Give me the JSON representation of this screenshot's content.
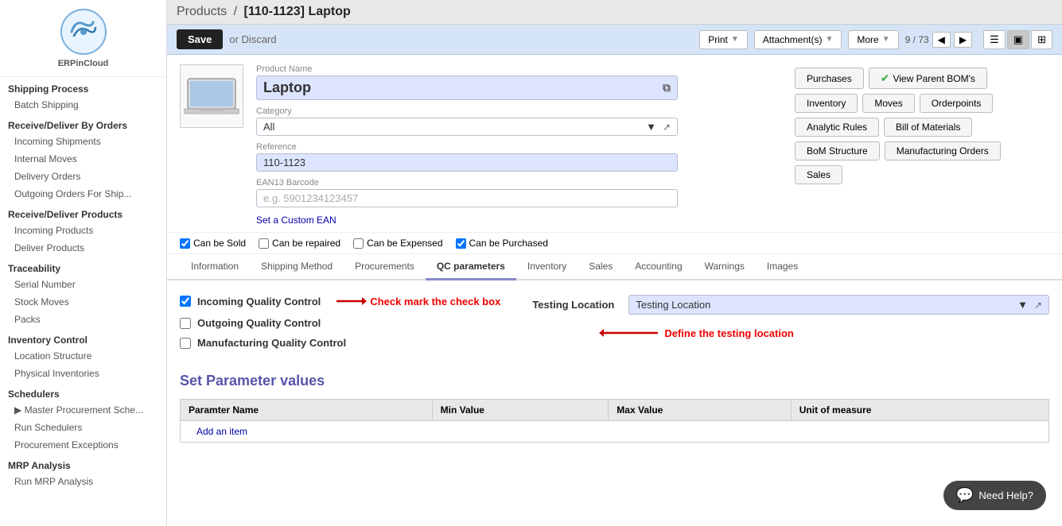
{
  "sidebar": {
    "logo_text": "ERPinCloud",
    "sections": [
      {
        "title": "Shipping Process",
        "items": [
          "Batch Shipping"
        ]
      },
      {
        "title": "Receive/Deliver By Orders",
        "items": [
          "Incoming Shipments",
          "Internal Moves",
          "Delivery Orders",
          "Outgoing Orders For Ship..."
        ]
      },
      {
        "title": "Receive/Deliver Products",
        "items": [
          "Incoming Products",
          "Deliver Products"
        ]
      },
      {
        "title": "Traceability",
        "items": [
          "Serial Number",
          "Stock Moves",
          "Packs"
        ]
      },
      {
        "title": "Inventory Control",
        "items": [
          "Location Structure",
          "Physical Inventories"
        ]
      },
      {
        "title": "Schedulers",
        "items": [
          "▶ Master Procurement Sche...",
          "Run Schedulers",
          "Procurement Exceptions"
        ]
      },
      {
        "title": "MRP Analysis",
        "items": [
          "Run MRP Analysis"
        ]
      }
    ]
  },
  "breadcrumb": {
    "parent": "Products",
    "separator": "/",
    "current": "[110-1123] Laptop"
  },
  "actionbar": {
    "save_label": "Save",
    "discard_label": "or Discard",
    "print_label": "Print",
    "attachments_label": "Attachment(s)",
    "more_label": "More",
    "pagination": "9 / 73"
  },
  "product": {
    "name_label": "Product Name",
    "name_value": "Laptop",
    "category_label": "Category",
    "category_value": "All",
    "reference_label": "Reference",
    "reference_value": "110-1123",
    "ean_label": "EAN13 Barcode",
    "ean_placeholder": "e.g. 5901234123457",
    "custom_ean_label": "Set a Custom EAN"
  },
  "checkboxes": {
    "can_be_sold_label": "Can be Sold",
    "can_be_sold_checked": true,
    "can_be_repaired_label": "Can be repaired",
    "can_be_repaired_checked": false,
    "can_be_expensed_label": "Can be Expensed",
    "can_be_expensed_checked": false,
    "can_be_purchased_label": "Can be Purchased",
    "can_be_purchased_checked": true
  },
  "right_buttons": {
    "purchases_label": "Purchases",
    "view_parent_bom_label": "View Parent BOM's",
    "inventory_label": "Inventory",
    "moves_label": "Moves",
    "orderpoints_label": "Orderpoints",
    "analytic_rules_label": "Analytic Rules",
    "bill_of_materials_label": "Bill of Materials",
    "bom_structure_label": "BoM Structure",
    "manufacturing_orders_label": "Manufacturing Orders",
    "sales_label": "Sales"
  },
  "tabs": {
    "items": [
      {
        "label": "Information",
        "active": false
      },
      {
        "label": "Shipping Method",
        "active": false
      },
      {
        "label": "Procurements",
        "active": false
      },
      {
        "label": "QC parameters",
        "active": true
      },
      {
        "label": "Inventory",
        "active": false
      },
      {
        "label": "Sales",
        "active": false
      },
      {
        "label": "Accounting",
        "active": false
      },
      {
        "label": "Warnings",
        "active": false
      },
      {
        "label": "Images",
        "active": false
      }
    ]
  },
  "qc": {
    "incoming_qc_label": "Incoming Quality Control",
    "incoming_qc_checked": true,
    "outgoing_qc_label": "Outgoing Quality Control",
    "outgoing_qc_checked": false,
    "manufacturing_qc_label": "Manufacturing Quality Control",
    "manufacturing_qc_checked": false,
    "testing_location_label": "Testing Location",
    "testing_location_value": "Testing Location",
    "annotation_checkbox": "Check mark the check box",
    "annotation_location": "Define the testing location"
  },
  "params": {
    "section_title": "Set Parameter values",
    "columns": [
      "Paramter Name",
      "Min Value",
      "Max Value",
      "Unit of measure"
    ],
    "add_item_label": "Add an item"
  },
  "help": {
    "label": "Need Help?"
  }
}
